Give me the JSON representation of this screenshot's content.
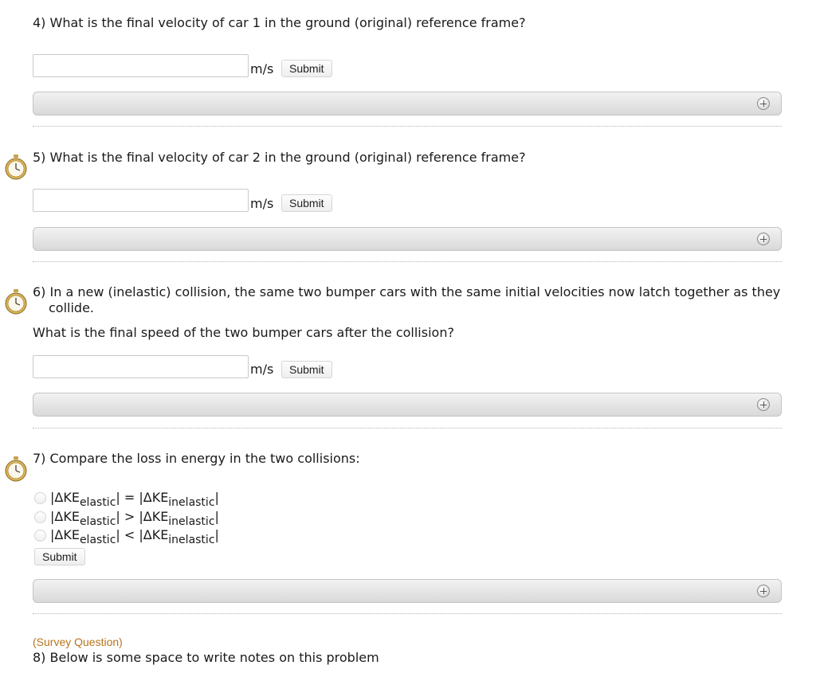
{
  "questions": [
    {
      "text": "4) What is the final velocity of car 1 in the ground (original) reference frame?",
      "unit": "m/s",
      "submit": "Submit",
      "input_value": ""
    },
    {
      "text": "5) What is the final velocity of car 2 in the ground (original) reference frame?",
      "unit": "m/s",
      "submit": "Submit",
      "input_value": ""
    },
    {
      "text": "6) In a new (inelastic) collision, the same two bumper cars with the same initial velocities now latch together as they collide.",
      "followup": "What is the final speed of the two bumper cars after the collision?",
      "unit": "m/s",
      "submit": "Submit",
      "input_value": ""
    }
  ],
  "q7": {
    "text": "7) Compare the loss in energy in the two collisions:",
    "options": [
      {
        "left": "|ΔKE",
        "left_sub": "elastic",
        "op": "| = |ΔKE",
        "right_sub": "inelastic",
        "end": "|"
      },
      {
        "left": "|ΔKE",
        "left_sub": "elastic",
        "op": "| > |ΔKE",
        "right_sub": "inelastic",
        "end": "|"
      },
      {
        "left": "|ΔKE",
        "left_sub": "elastic",
        "op": "| < |ΔKE",
        "right_sub": "inelastic",
        "end": "|"
      }
    ],
    "submit": "Submit"
  },
  "survey": {
    "tag": "(Survey Question)",
    "text": "8) Below is some space to write notes on this problem"
  },
  "icons": {
    "clock": "stopwatch-icon",
    "expand": "plus-circle-icon"
  },
  "colors": {
    "survey_tag": "#b8731c",
    "bar_top": "#f2f2f2",
    "bar_bottom": "#d9d9d9"
  }
}
